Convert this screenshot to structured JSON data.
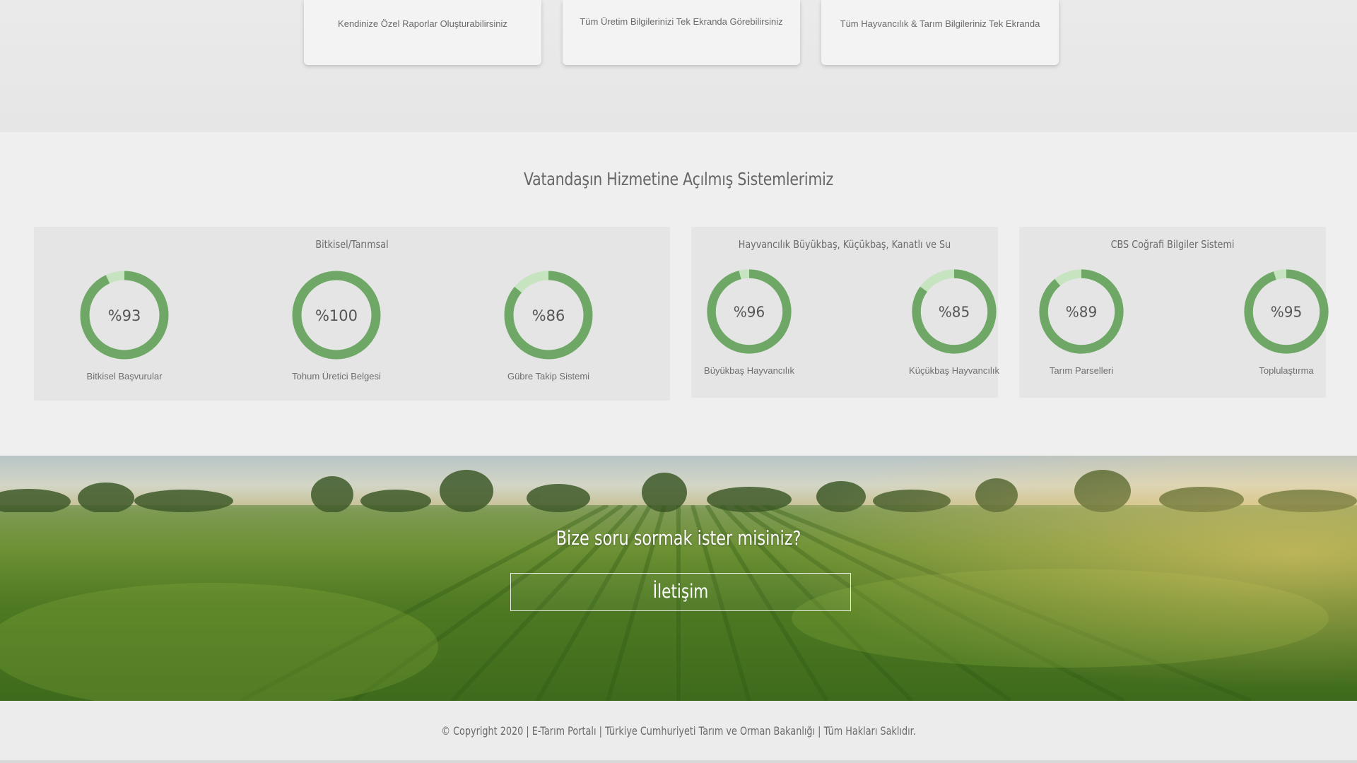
{
  "features": [
    {
      "text": "Kendinize Özel Raporlar Oluşturabilirsiniz"
    },
    {
      "text": "Tüm Üretim Bilgilerinizi Tek Ekranda Görebilirsiniz"
    },
    {
      "text": "Tüm Hayvancılık & Tarım Bilgileriniz Tek Ekranda"
    }
  ],
  "systems": {
    "title": "Vatandaşın Hizmetine Açılmış Sistemlerimiz",
    "groups": [
      {
        "title": "Bitkisel/Tarımsal",
        "items": [
          {
            "value": "%93",
            "percent": 93,
            "label": "Bitkisel Başvurular"
          },
          {
            "value": "%100",
            "percent": 100,
            "label": "Tohum Üretici Belgesi"
          },
          {
            "value": "%86",
            "percent": 86,
            "label": "Gübre Takip Sistemi"
          }
        ]
      },
      {
        "title": "Hayvancılık Büyükbaş, Küçükbaş, Kanatlı ve Su",
        "items": [
          {
            "value": "%96",
            "percent": 96,
            "label": "Büyükbaş Hayvancılık"
          },
          {
            "value": "%85",
            "percent": 85,
            "label": "Küçükbaş Hayvancılık"
          }
        ]
      },
      {
        "title": "CBS Coğrafi Bilgiler Sistemi",
        "items": [
          {
            "value": "%89",
            "percent": 89,
            "label": "Tarım Parselleri"
          },
          {
            "value": "%95",
            "percent": 95,
            "label": "Toplulaştırma"
          }
        ]
      }
    ]
  },
  "banner": {
    "question": "Bize soru sormak ister misiniz?",
    "button_label": "İletişim"
  },
  "footer": {
    "copyright": "© Copyright 2020 | E-Tarım Portalı | Türkiye Cumhuriyeti Tarım ve Orman Bakanlığı | Tüm Hakları Saklıdır."
  },
  "colors": {
    "donut_fill": "#6fa866",
    "donut_track": "#c5e4bf",
    "page_bg": "#efefef",
    "group_bg": "#e5e5e5"
  }
}
